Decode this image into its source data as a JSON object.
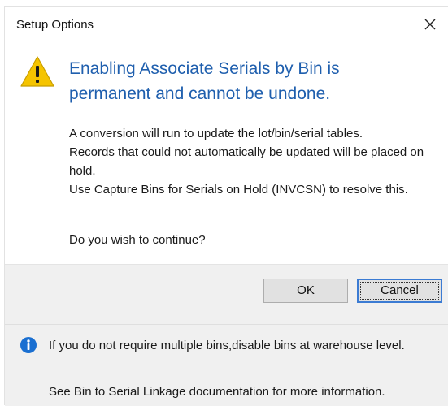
{
  "window": {
    "title": "Setup Options",
    "close_icon": "close-icon"
  },
  "message": {
    "icon": "warning-icon",
    "heading": "Enabling Associate Serials by Bin is permanent and cannot be undone.",
    "body_lines": [
      "A conversion will run to update the lot/bin/serial tables.",
      "Records that could not automatically be updated will be placed on hold.",
      "Use Capture Bins for Serials on Hold (INVCSN) to resolve this."
    ],
    "question": "Do you wish to continue?"
  },
  "buttons": {
    "ok_label": "OK",
    "cancel_label": "Cancel"
  },
  "footer": {
    "icon": "info-icon",
    "note": "If you do not require multiple bins,disable bins at warehouse level.",
    "link_text": "See Bin to Serial Linkage documentation for more information."
  },
  "colors": {
    "heading": "#1f5fae",
    "warning": "#f5c400",
    "info": "#1a6fd1",
    "focus_border": "#3b7bd3"
  }
}
